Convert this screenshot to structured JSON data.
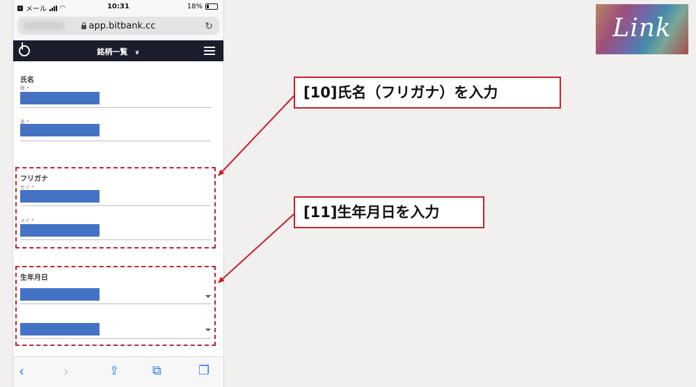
{
  "status_bar": {
    "carrier": "メール",
    "time": "10:31",
    "battery": "18%",
    "battery_level": 0.18
  },
  "browser": {
    "url": "app.bitbank.cc"
  },
  "app_nav": {
    "title": "銘柄一覧",
    "chevron": "∨"
  },
  "form": {
    "name_section": {
      "title": "氏名",
      "last_label": "姓 *",
      "first_label": "名 *"
    },
    "kana_section": {
      "title": "フリガナ",
      "last_label": "セイ *",
      "first_label": "メイ *"
    },
    "birth_section": {
      "title": "生年月日"
    }
  },
  "annotations": {
    "callout_kana": "[10]氏名（フリガナ）を入力",
    "callout_birth": "[11]生年月日を入力"
  },
  "brand": {
    "logo_text": "Link"
  },
  "colors": {
    "highlight": "#c81e25",
    "fill": "#4472c4",
    "nav_bg": "#1a1d2b",
    "ios_blue": "#2f7cf6"
  },
  "toolbar_icons": [
    "back-icon",
    "forward-icon",
    "share-icon",
    "bookmarks-icon",
    "tabs-icon"
  ]
}
